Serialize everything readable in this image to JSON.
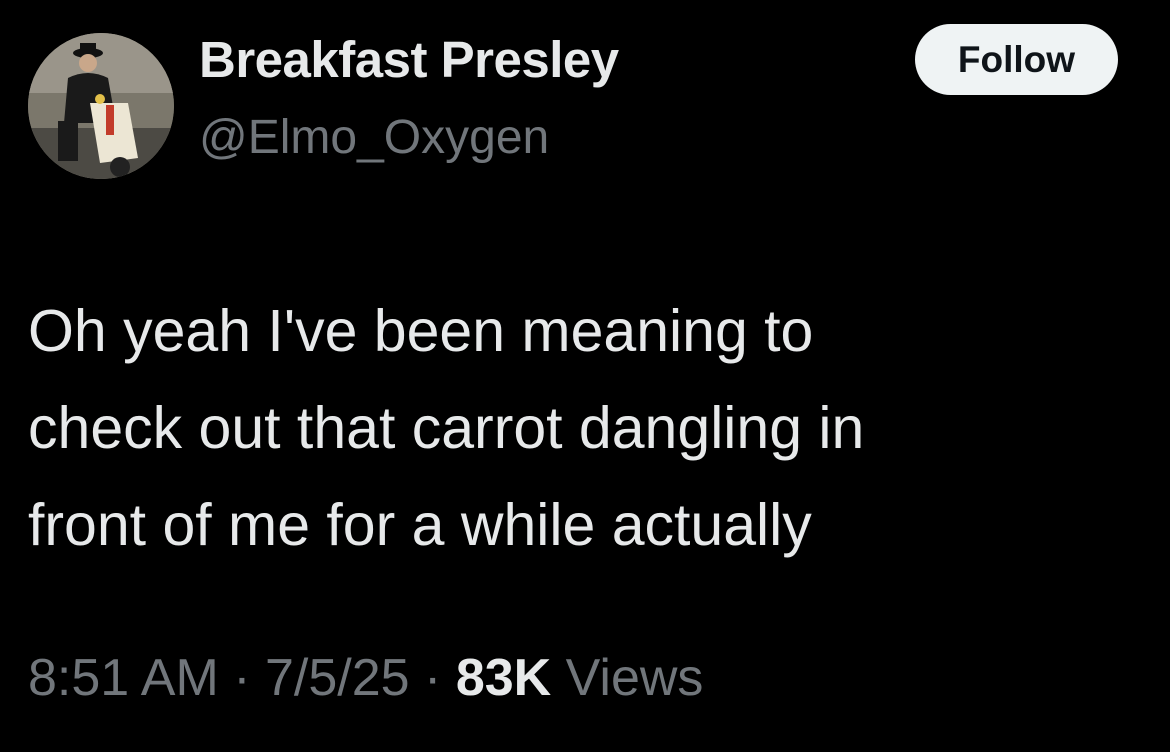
{
  "author": {
    "display_name": "Breakfast Presley",
    "handle": "@Elmo_Oxygen",
    "avatar_icon": "profile-photo-man-on-scooter"
  },
  "follow_button": {
    "label": "Follow"
  },
  "tweet": {
    "lines": [
      "Oh yeah I've been meaning to",
      "check out that carrot dangling in",
      "front of me for a while actually"
    ]
  },
  "meta": {
    "time": "8:51 AM",
    "separator1": " · ",
    "date": "7/5/25",
    "separator2": " · ",
    "views_count": "83K",
    "views_label": " Views"
  },
  "colors": {
    "background": "#000000",
    "primary_text": "#e7e9ea",
    "secondary_text": "#71767b",
    "button_bg": "#eff3f4",
    "button_text": "#0f1419"
  }
}
